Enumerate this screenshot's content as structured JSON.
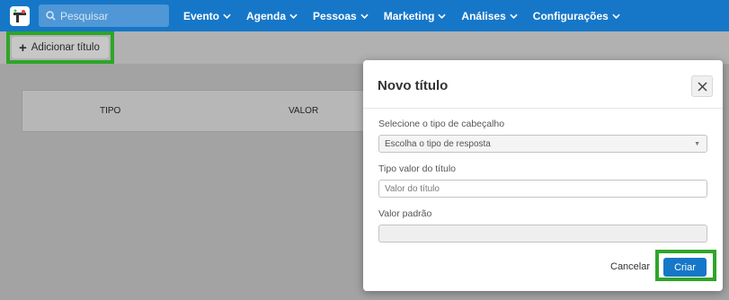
{
  "nav": {
    "search_placeholder": "Pesquisar",
    "items": [
      {
        "label": "Evento"
      },
      {
        "label": "Agenda"
      },
      {
        "label": "Pessoas"
      },
      {
        "label": "Marketing"
      },
      {
        "label": "Análises"
      },
      {
        "label": "Configurações"
      }
    ],
    "accent": "#1677c8"
  },
  "toolbar": {
    "add_title_label": "Adicionar título",
    "highlight_color": "#2fa52a"
  },
  "table": {
    "headers": [
      "TIPO",
      "VALOR"
    ]
  },
  "modal": {
    "title": "Novo título",
    "fields": {
      "header_type_label": "Selecione o tipo de cabeçalho",
      "header_type_value": "Escolha o tipo de resposta",
      "title_value_label": "Tipo valor do título",
      "title_value_placeholder": "Valor do título",
      "default_value_label": "Valor padrão",
      "default_value_value": ""
    },
    "cancel_label": "Cancelar",
    "create_label": "Criar"
  }
}
